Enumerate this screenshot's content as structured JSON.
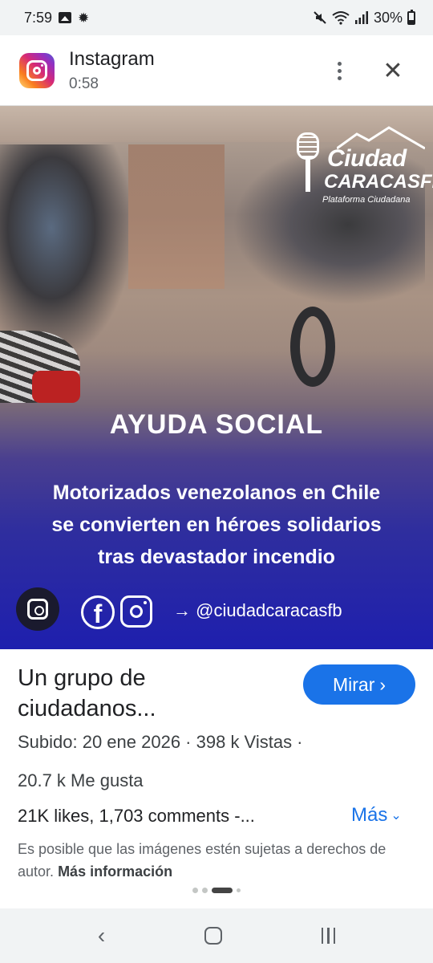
{
  "status_bar": {
    "time": "7:59",
    "battery": "30%",
    "icons": [
      "gallery-icon",
      "brightness-icon",
      "mute-icon",
      "wifi-icon",
      "signal-icon",
      "battery-icon"
    ]
  },
  "header": {
    "app_name": "Instagram",
    "duration": "0:58",
    "icons": [
      "instagram-icon",
      "more-vert-icon",
      "close-icon"
    ]
  },
  "image": {
    "logo_line1": "Ciudad",
    "logo_line2": "CARACASFB",
    "logo_tagline": "Plataforma Ciudadana",
    "heading": "AYUDA SOCIAL",
    "body_line1": "Motorizados venezolanos en Chile",
    "body_line2": "se convierten en héroes solidarios",
    "body_line3": "tras devastador incendio",
    "arrow": "→",
    "handle": "@ciudadcaracasfb",
    "accent": "#1e1fae"
  },
  "info": {
    "title_line1": "Un grupo de",
    "title_line2": "ciudadanos...",
    "watch_label": "Mirar",
    "watch_chevron": "›",
    "meta_line1": "Subido: 20 ene 2026 · 398 k Vistas ·",
    "meta_line2": "20.7 k Me gusta",
    "description": "21K likes, 1,703 comments -...",
    "more_label": "Más",
    "more_chevron": "⌄",
    "copyright_text": "Es posible que las imágenes estén sujetas a derechos de autor.",
    "more_info_label": "Más información",
    "accent": "#1a73e8"
  },
  "carousel": {
    "active_index": 2,
    "count": 4
  },
  "navbar": {
    "back_glyph": "‹"
  }
}
